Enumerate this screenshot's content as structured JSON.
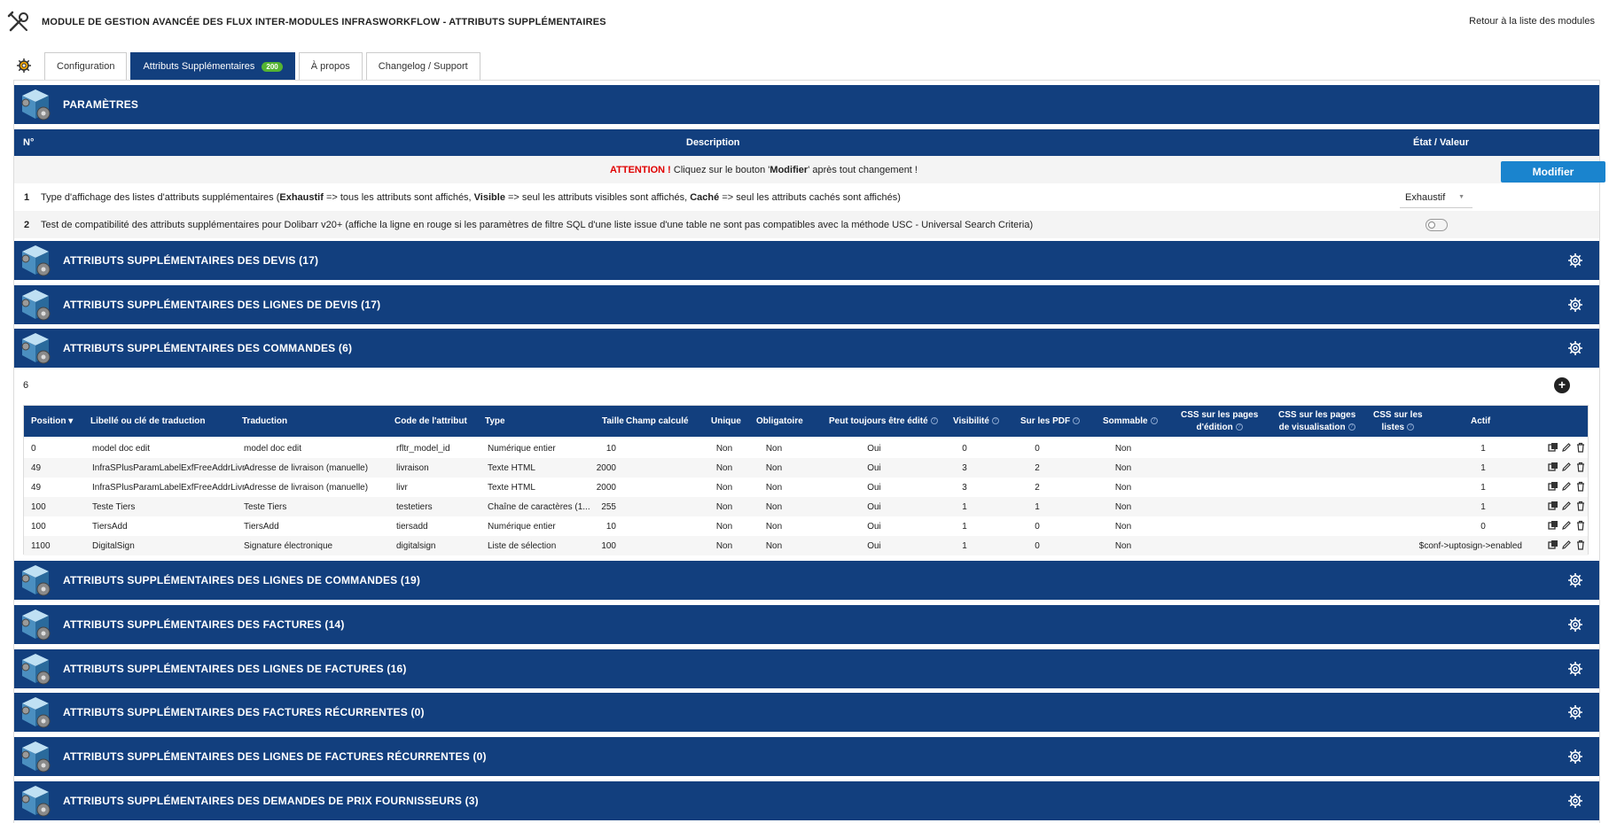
{
  "header": {
    "title": "MODULE DE GESTION AVANCÉE DES FLUX INTER-MODULES INFRASWORKFLOW - ATTRIBUTS SUPPLÉMENTAIRES",
    "back_link": "Retour à la liste des modules"
  },
  "tabs": [
    {
      "label": "Configuration",
      "active": false
    },
    {
      "label": "Attributs Supplémentaires",
      "badge": "200",
      "active": true
    },
    {
      "label": "À propos",
      "active": false
    },
    {
      "label": "Changelog / Support",
      "active": false
    }
  ],
  "params": {
    "title": "PARAMÈTRES",
    "col_num": "N°",
    "col_desc": "Description",
    "col_state": "État / Valeur",
    "warning_prefix": "ATTENTION !",
    "warning_before": " Cliquez sur le bouton '",
    "warning_bold": "Modifier",
    "warning_after": "' après tout changement !",
    "modify_label": "Modifier",
    "rows": [
      {
        "num": "1",
        "t1": "Type d'affichage des listes d'attributs supplémentaires (",
        "b1": "Exhaustif",
        "t2": " => tous les attributs sont affichés, ",
        "b2": "Visible",
        "t3": " => seul les attributs visibles sont affichés, ",
        "b3": "Caché",
        "t4": " => seul les attributs cachés sont affichés)",
        "value": "Exhaustif"
      },
      {
        "num": "2",
        "text": "Test de compatibilité des attributs supplémentaires pour Dolibarr v20+ (affiche la ligne en rouge si les paramètres de filtre SQL d'une liste issue d'une table ne sont pas compatibles avec la méthode USC - Universal Search Criteria)",
        "toggle": false
      }
    ]
  },
  "sections": [
    "ATTRIBUTS SUPPLÉMENTAIRES DES DEVIS (17)",
    "ATTRIBUTS SUPPLÉMENTAIRES DES LIGNES DE DEVIS (17)",
    "ATTRIBUTS SUPPLÉMENTAIRES DES COMMANDES (6)",
    "ATTRIBUTS SUPPLÉMENTAIRES DES LIGNES DE COMMANDES (19)",
    "ATTRIBUTS SUPPLÉMENTAIRES DES FACTURES (14)",
    "ATTRIBUTS SUPPLÉMENTAIRES DES LIGNES DE FACTURES (16)",
    "ATTRIBUTS SUPPLÉMENTAIRES DES FACTURES RÉCURRENTES (0)",
    "ATTRIBUTS SUPPLÉMENTAIRES DES LIGNES DE FACTURES RÉCURRENTES (0)",
    "ATTRIBUTS SUPPLÉMENTAIRES DES DEMANDES DE PRIX FOURNISSEURS (3)"
  ],
  "orders_table": {
    "count": "6",
    "headers": {
      "position": "Position",
      "label": "Libellé ou clé de traduction",
      "translation": "Traduction",
      "code": "Code de l'attribut",
      "type": "Type",
      "size": "Taille",
      "computed": "Champ calculé",
      "unique": "Unique",
      "required": "Obligatoire",
      "always_editable": "Peut toujours être édité",
      "visibility": "Visibilité",
      "on_pdf": "Sur les PDF",
      "summable": "Sommable",
      "css_edit_1": "CSS sur les pages",
      "css_edit_2": "d'édition",
      "css_view_1": "CSS sur les pages",
      "css_view_2": "de visualisation",
      "css_list_1": "CSS sur les",
      "css_list_2": "listes",
      "active": "Actif"
    },
    "rows": [
      {
        "position": "0",
        "label": "model doc edit",
        "translation": "model doc edit",
        "code": "rfltr_model_id",
        "type": "Numérique entier",
        "size": "10",
        "unique": "Non",
        "required": "Non",
        "always_editable": "Oui",
        "visibility": "0",
        "on_pdf": "0",
        "summable": "Non",
        "active": "1",
        "css_list": ""
      },
      {
        "position": "49",
        "label": "InfraSPlusParamLabelExfFreeAddrLivr",
        "translation": "Adresse de livraison (manuelle)",
        "code": "livraison",
        "type": "Texte HTML",
        "size": "2000",
        "unique": "Non",
        "required": "Non",
        "always_editable": "Oui",
        "visibility": "3",
        "on_pdf": "2",
        "summable": "Non",
        "active": "1",
        "css_list": ""
      },
      {
        "position": "49",
        "label": "InfraSPlusParamLabelExfFreeAddrLivr",
        "translation": "Adresse de livraison (manuelle)",
        "code": "livr",
        "type": "Texte HTML",
        "size": "2000",
        "unique": "Non",
        "required": "Non",
        "always_editable": "Oui",
        "visibility": "3",
        "on_pdf": "2",
        "summable": "Non",
        "active": "1",
        "css_list": ""
      },
      {
        "position": "100",
        "label": "Teste Tiers",
        "translation": "Teste Tiers",
        "code": "testetiers",
        "type": "Chaîne de caractères (1...",
        "size": "255",
        "unique": "Non",
        "required": "Non",
        "always_editable": "Oui",
        "visibility": "1",
        "on_pdf": "1",
        "summable": "Non",
        "active": "1",
        "css_list": ""
      },
      {
        "position": "100",
        "label": "TiersAdd",
        "translation": "TiersAdd",
        "code": "tiersadd",
        "type": "Numérique entier",
        "size": "10",
        "unique": "Non",
        "required": "Non",
        "always_editable": "Oui",
        "visibility": "1",
        "on_pdf": "0",
        "summable": "Non",
        "active": "0",
        "css_list": ""
      },
      {
        "position": "1100",
        "label": "DigitalSign",
        "translation": "Signature électronique",
        "code": "digitalsign",
        "type": "Liste de sélection",
        "size": "100",
        "unique": "Non",
        "required": "Non",
        "always_editable": "Oui",
        "visibility": "1",
        "on_pdf": "0",
        "summable": "Non",
        "active": "",
        "css_list": "$conf->uptosign->enabled"
      }
    ]
  },
  "colors": {
    "header_blue": "#123f7e",
    "button_blue": "#1a84ce",
    "badge_green": "#55b432",
    "warning_red": "#e00000"
  }
}
